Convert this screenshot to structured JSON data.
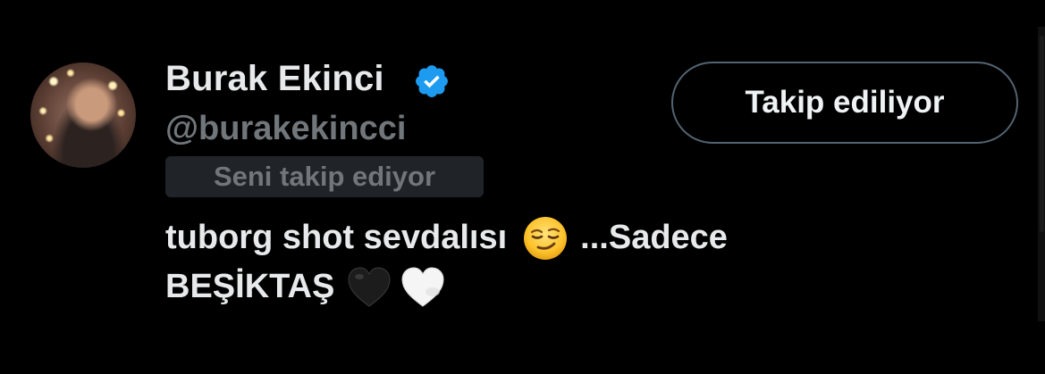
{
  "profile": {
    "display_name": "Burak Ekinci",
    "username": "@burakekincci",
    "verified": true,
    "follows_you_label": "Seni takip ediyor",
    "follow_button_label": "Takip ediliyor"
  },
  "bio": {
    "line1_before": "tuborg shot sevdalısı",
    "line1_emoji": "smirking-face-icon",
    "line1_after": "...Sadece",
    "line2_text": "BEŞİKTAŞ",
    "line2_emojis": [
      "black-heart-icon",
      "white-heart-icon"
    ]
  },
  "colors": {
    "background": "#000000",
    "primary_text": "#e7e9ea",
    "secondary_text": "#71767b",
    "verified_badge": "#1d9bf0",
    "badge_background": "#202327",
    "button_border": "#536471"
  }
}
